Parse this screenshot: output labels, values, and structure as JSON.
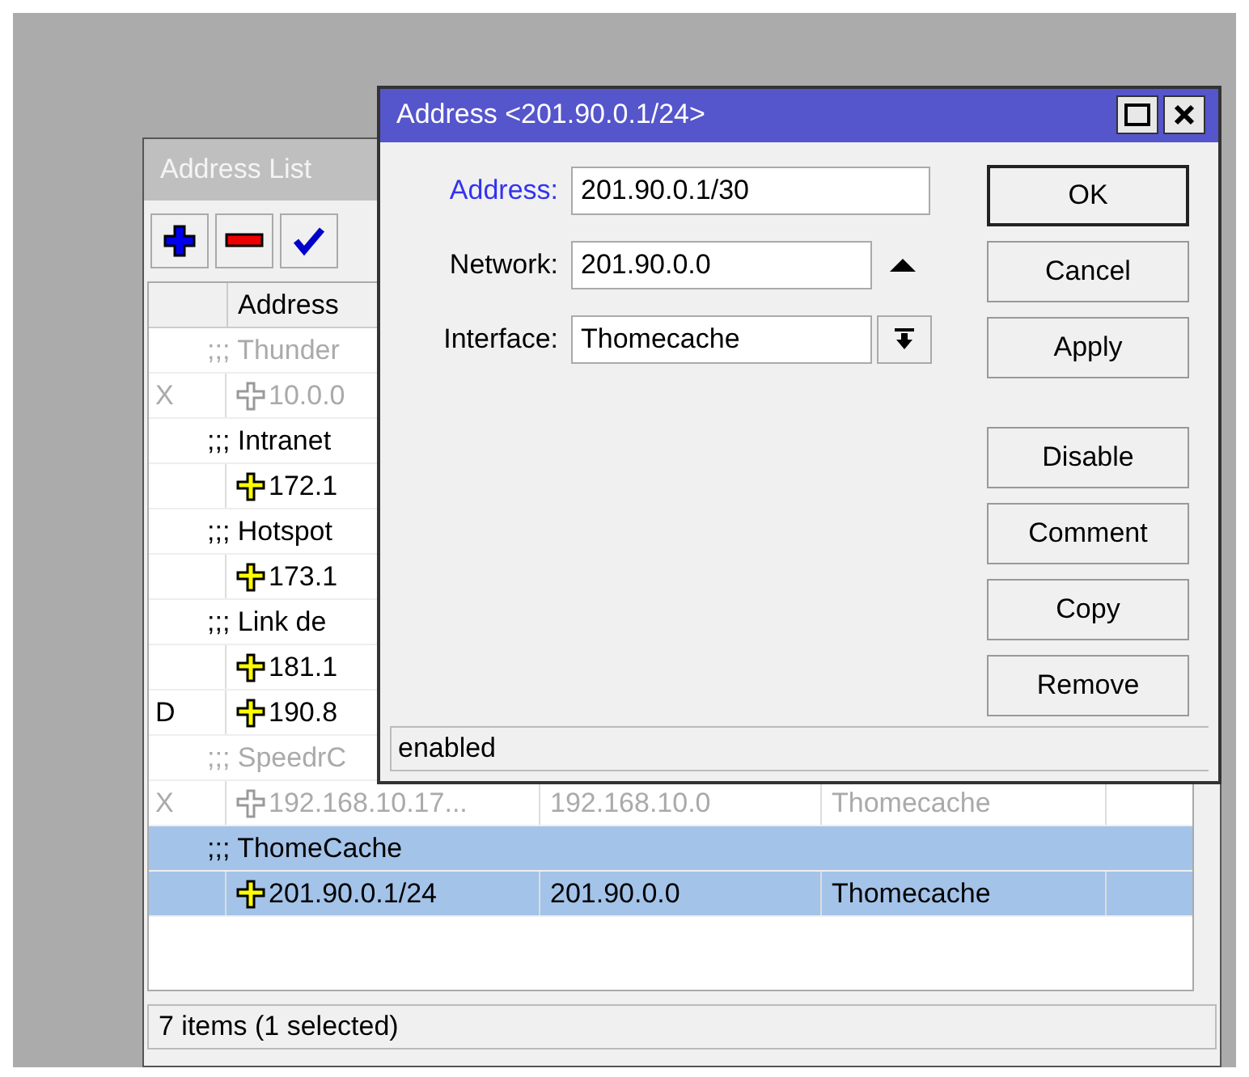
{
  "list_window": {
    "title": "Address List",
    "header": "Address",
    "rows": [
      {
        "kind": "comment",
        "text": ";;; Thunder",
        "disabled": true,
        "selected": false
      },
      {
        "kind": "address",
        "flag": "X",
        "address": "10.0.0",
        "disabled": true,
        "selected": false
      },
      {
        "kind": "comment",
        "text": ";;; Intranet",
        "disabled": false,
        "selected": false
      },
      {
        "kind": "address",
        "address": "172.1",
        "disabled": false,
        "selected": false
      },
      {
        "kind": "comment",
        "text": ";;; Hotspot",
        "disabled": false,
        "selected": false
      },
      {
        "kind": "address",
        "address": "173.1",
        "disabled": false,
        "selected": false
      },
      {
        "kind": "comment",
        "text": ";;; Link de",
        "disabled": false,
        "selected": false
      },
      {
        "kind": "address",
        "address": "181.1",
        "disabled": false,
        "selected": false
      },
      {
        "kind": "address",
        "flag": "D",
        "address": "190.8",
        "disabled": false,
        "selected": false
      },
      {
        "kind": "comment",
        "text": ";;; SpeedrC",
        "disabled": true,
        "selected": false
      },
      {
        "kind": "address",
        "flag": "X",
        "address": "192.168.10.17...",
        "network": "192.168.10.0",
        "interface": "Thomecache",
        "disabled": true,
        "selected": false
      },
      {
        "kind": "comment",
        "text": ";;; ThomeCache",
        "disabled": false,
        "selected": true
      },
      {
        "kind": "address",
        "address": "201.90.0.1/24",
        "network": "201.90.0.0",
        "interface": "Thomecache",
        "disabled": false,
        "selected": true
      }
    ],
    "status": "7 items (1 selected)"
  },
  "dialog": {
    "title": "Address <201.90.0.1/24>",
    "fields": [
      {
        "kind": "text",
        "label": "Address:",
        "value": "201.90.0.1/30",
        "focused": true
      },
      {
        "kind": "toggle",
        "label": "Network:",
        "value": "201.90.0.0",
        "focused": false
      },
      {
        "kind": "dropdown",
        "label": "Interface:",
        "value": "Thomecache",
        "focused": false
      }
    ],
    "buttons": [
      {
        "label": "OK",
        "default": true
      },
      {
        "label": "Cancel",
        "default": false
      },
      {
        "label": "Apply",
        "default": false
      }
    ],
    "action_buttons": [
      {
        "label": "Disable"
      },
      {
        "label": "Comment"
      },
      {
        "label": "Copy"
      },
      {
        "label": "Remove"
      }
    ],
    "status": "enabled"
  }
}
